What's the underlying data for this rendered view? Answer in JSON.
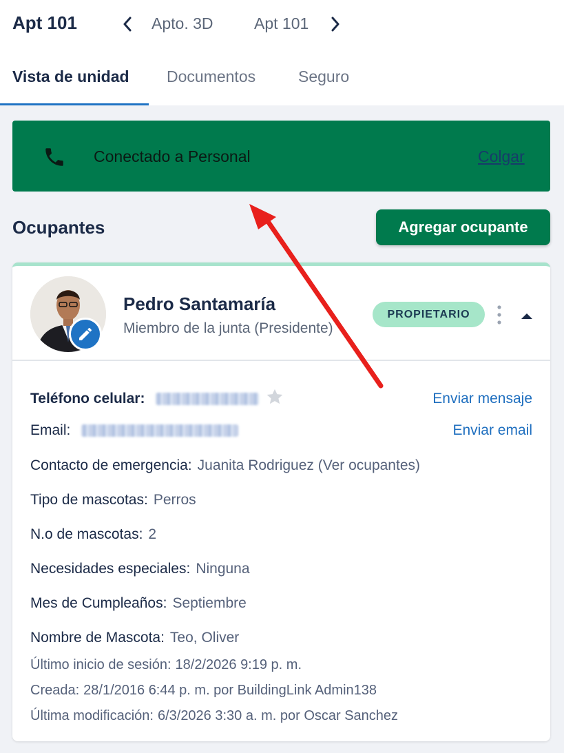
{
  "header": {
    "unit_title": "Apt 101",
    "prev_unit": "Apto. 3D",
    "next_unit": "Apt 101"
  },
  "tabs": [
    {
      "label": "Vista de unidad",
      "active": true
    },
    {
      "label": "Documentos",
      "active": false
    },
    {
      "label": "Seguro",
      "active": false
    }
  ],
  "call_banner": {
    "text": "Conectado a Personal",
    "hangup_label": "Colgar",
    "icon": "phone-icon",
    "color": "#007a4d"
  },
  "occupants": {
    "heading": "Ocupantes",
    "add_button": "Agregar ocupante"
  },
  "occupant": {
    "name": "Pedro Santamaría",
    "role": "Miembro de la junta (Presidente)",
    "badge": "PROPIETARIO",
    "cell_phone_label": "Teléfono celular:",
    "send_message": "Enviar mensaje",
    "email_label": "Email:",
    "send_email": "Enviar email",
    "emergency_label": "Contacto de emergencia:",
    "emergency_value": "Juanita Rodriguez (Ver ocupantes)",
    "pet_type_label": "Tipo de mascotas:",
    "pet_type_value": "Perros",
    "pet_count_label": "N.o de mascotas:",
    "pet_count_value": "2",
    "special_needs_label": "Necesidades especiales:",
    "special_needs_value": "Ninguna",
    "birthday_label": "Mes de Cumpleaños:",
    "birthday_value": "Septiembre",
    "pet_name_label": "Nombre de Mascota:",
    "pet_name_value": "Teo, Oliver",
    "last_login_label": "Último inicio de sesión:",
    "last_login_value": "18/2/2026 9:19 p. m.",
    "created_label": "Creada:",
    "created_value": "28/1/2016 6:44 p. m. por BuildingLink Admin138",
    "modified_label": "Última modificación:",
    "modified_value": "6/3/2026 3:30 a. m. por Oscar Sanchez"
  },
  "colors": {
    "accent_green": "#007a4d",
    "badge_green": "#a6e6c9",
    "link_blue": "#1f6fbf",
    "annotation_arrow": "#e8201c"
  }
}
